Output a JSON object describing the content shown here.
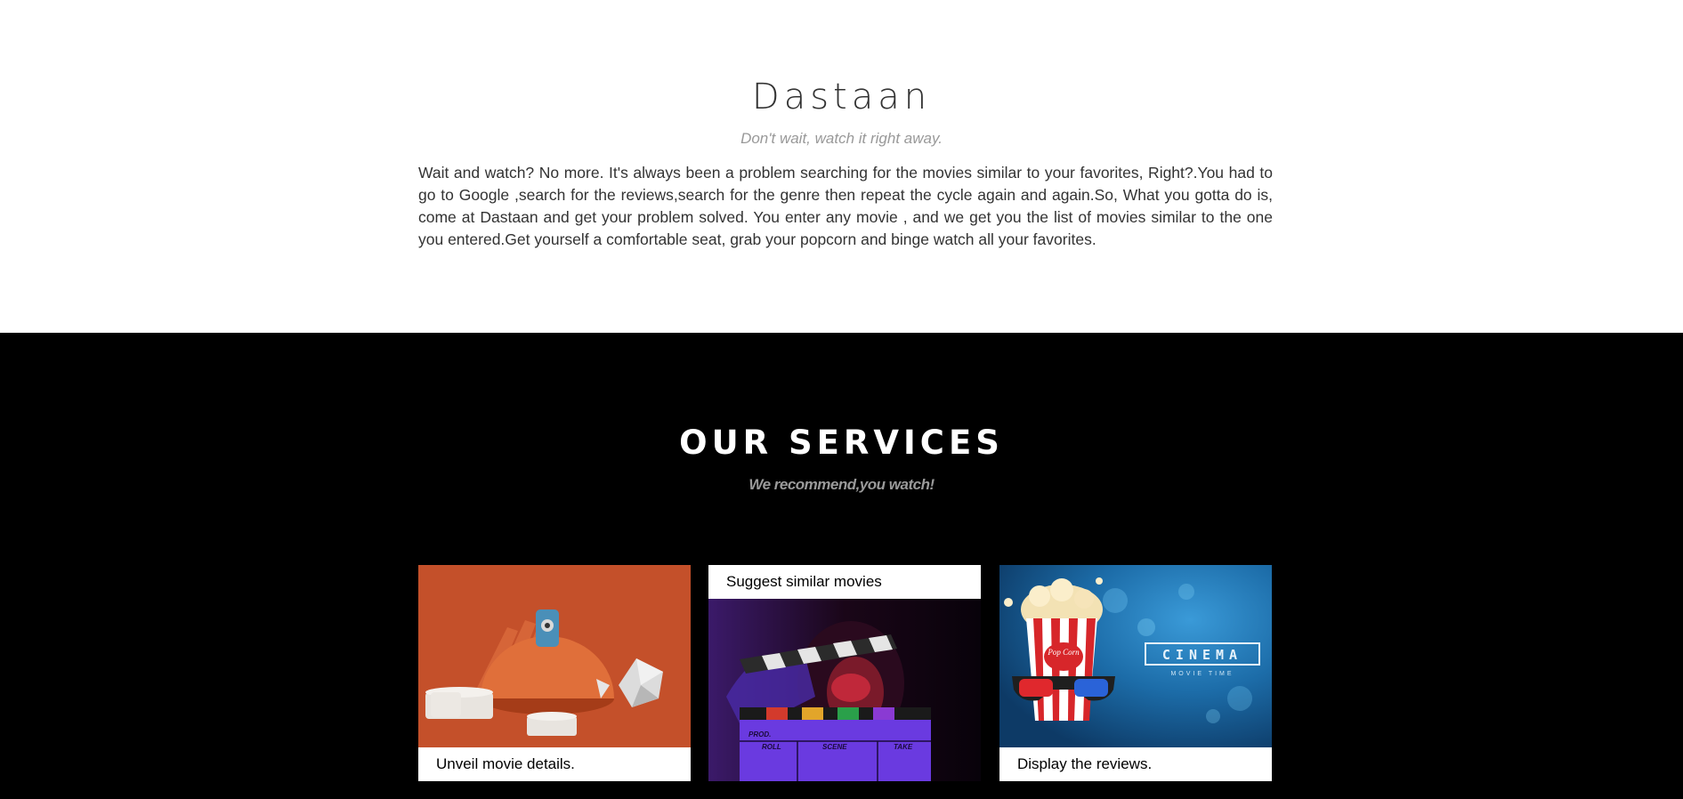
{
  "about": {
    "title": "Dastaan",
    "tagline": "Don't wait, watch it right away.",
    "text": "Wait and watch? No more. It's always been a problem searching for the movies similar to your favorites, Right?.You had to go to Google ,search for the reviews,search for the genre then repeat the cycle again and again.So, What you gotta do is, come at Dastaan and get your problem solved. You enter any movie , and we get you the list of movies similar to the one you entered.Get yourself a comfortable seat, grab your popcorn and binge watch all your favorites."
  },
  "services": {
    "title": "OUR SERVICES",
    "tagline": "We recommend,you watch!",
    "cards": [
      {
        "caption": "Unveil movie details."
      },
      {
        "caption": "Suggest similar movies",
        "clapper": [
          "PROD.",
          "ROLL",
          "SCENE",
          "TAKE"
        ]
      },
      {
        "caption": "Display the reviews.",
        "popcorn": "Pop Corn",
        "cinema": "CINEMA",
        "cinema_sub": "MOVIE TIME"
      }
    ]
  },
  "colors": {
    "about_bg": "#ffffff",
    "services_bg": "#000000",
    "heading_dark": "#333333",
    "tagline_grey": "#999999"
  }
}
